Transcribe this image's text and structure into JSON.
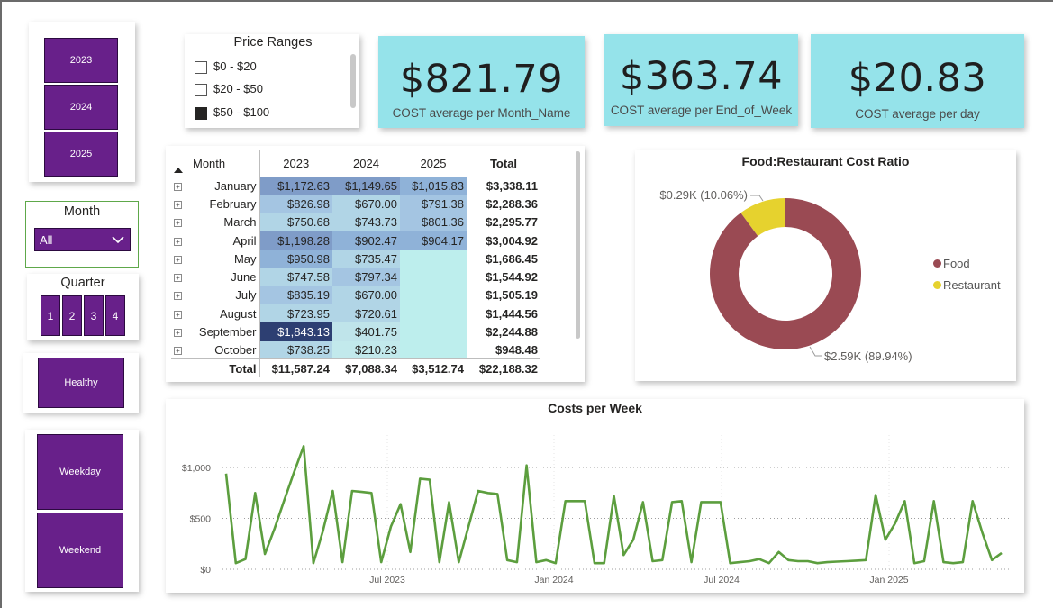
{
  "year_slicer": {
    "items": [
      "2023",
      "2024",
      "2025"
    ]
  },
  "month_slicer": {
    "title": "Month",
    "selected": "All"
  },
  "quarter_slicer": {
    "title": "Quarter",
    "items": [
      "1",
      "2",
      "3",
      "4"
    ]
  },
  "healthy_button": {
    "label": "Healthy"
  },
  "day_type_slicer": {
    "items": [
      "Weekday",
      "Weekend"
    ]
  },
  "price_ranges": {
    "title": "Price Ranges",
    "items": [
      {
        "label": "$0 - $20",
        "checked": false
      },
      {
        "label": "$20 - $50",
        "checked": false
      },
      {
        "label": "$50 - $100",
        "checked": true
      }
    ]
  },
  "kpis": [
    {
      "value": "$821.79",
      "label": "COST average per Month_Name"
    },
    {
      "value": "$363.74",
      "label": "COST average per End_of_Week"
    },
    {
      "value": "$20.83",
      "label": "COST average per day"
    }
  ],
  "matrix": {
    "headers": [
      "Month",
      "2023",
      "2024",
      "2025",
      "Total"
    ],
    "rows": [
      {
        "month": "January",
        "values": [
          "$1,172.63",
          "$1,149.65",
          "$1,015.83"
        ],
        "total": "$3,338.11",
        "raw": [
          1172.63,
          1149.65,
          1015.83
        ]
      },
      {
        "month": "February",
        "values": [
          "$826.98",
          "$670.00",
          "$791.38"
        ],
        "total": "$2,288.36",
        "raw": [
          826.98,
          670.0,
          791.38
        ]
      },
      {
        "month": "March",
        "values": [
          "$750.68",
          "$743.73",
          "$801.36"
        ],
        "total": "$2,295.77",
        "raw": [
          750.68,
          743.73,
          801.36
        ]
      },
      {
        "month": "April",
        "values": [
          "$1,198.28",
          "$902.47",
          "$904.17"
        ],
        "total": "$3,004.92",
        "raw": [
          1198.28,
          902.47,
          904.17
        ]
      },
      {
        "month": "May",
        "values": [
          "$950.98",
          "$735.47",
          ""
        ],
        "total": "$1,686.45",
        "raw": [
          950.98,
          735.47,
          null
        ]
      },
      {
        "month": "June",
        "values": [
          "$747.58",
          "$797.34",
          ""
        ],
        "total": "$1,544.92",
        "raw": [
          747.58,
          797.34,
          null
        ]
      },
      {
        "month": "July",
        "values": [
          "$835.19",
          "$670.00",
          ""
        ],
        "total": "$1,505.19",
        "raw": [
          835.19,
          670.0,
          null
        ]
      },
      {
        "month": "August",
        "values": [
          "$723.95",
          "$720.61",
          ""
        ],
        "total": "$1,444.56",
        "raw": [
          723.95,
          720.61,
          null
        ]
      },
      {
        "month": "September",
        "values": [
          "$1,843.13",
          "$401.75",
          ""
        ],
        "total": "$2,244.88",
        "raw": [
          1843.13,
          401.75,
          null
        ]
      },
      {
        "month": "October",
        "values": [
          "$738.25",
          "$210.23",
          ""
        ],
        "total": "$948.48",
        "raw": [
          738.25,
          210.23,
          null
        ]
      }
    ],
    "total_row": {
      "label": "Total",
      "values": [
        "$11,587.24",
        "$7,088.34",
        "$3,512.74"
      ],
      "total": "$22,188.32"
    }
  },
  "chart_data": [
    {
      "type": "pie",
      "title": "Food:Restaurant Cost Ratio",
      "slices": [
        {
          "name": "Food",
          "value": 2.59,
          "label": "$2.59K (89.94%)",
          "color": "#9a4a53"
        },
        {
          "name": "Restaurant",
          "value": 0.29,
          "label": "$0.29K (10.06%)",
          "color": "#e6d22e"
        }
      ],
      "legend_position": "right"
    },
    {
      "type": "line",
      "title": "Costs per Week",
      "xlabel": "",
      "ylabel": "",
      "x_tick_labels": [
        "Jul 2023",
        "Jan 2024",
        "Jul 2024",
        "Jan 2025"
      ],
      "y_tick_labels": [
        "$0",
        "$500",
        "$1,000"
      ],
      "ylim": [
        0,
        1100
      ],
      "grid": true,
      "series": [
        {
          "color": "#5c9e3e",
          "values": [
            940,
            60,
            100,
            750,
            150,
            400,
            680,
            950,
            1210,
            60,
            380,
            770,
            70,
            770,
            760,
            750,
            70,
            420,
            640,
            170,
            890,
            880,
            70,
            660,
            70,
            420,
            770,
            750,
            740,
            90,
            70,
            1020,
            70,
            90,
            60,
            670,
            670,
            670,
            60,
            60,
            720,
            140,
            290,
            660,
            80,
            90,
            660,
            670,
            70,
            660,
            660,
            660,
            60,
            70,
            80,
            100,
            60,
            170,
            90,
            80,
            80,
            60,
            70,
            75,
            80,
            85,
            90,
            730,
            290,
            450,
            670,
            60,
            80,
            670,
            70,
            60,
            70,
            670,
            360,
            90,
            160
          ]
        }
      ]
    }
  ]
}
